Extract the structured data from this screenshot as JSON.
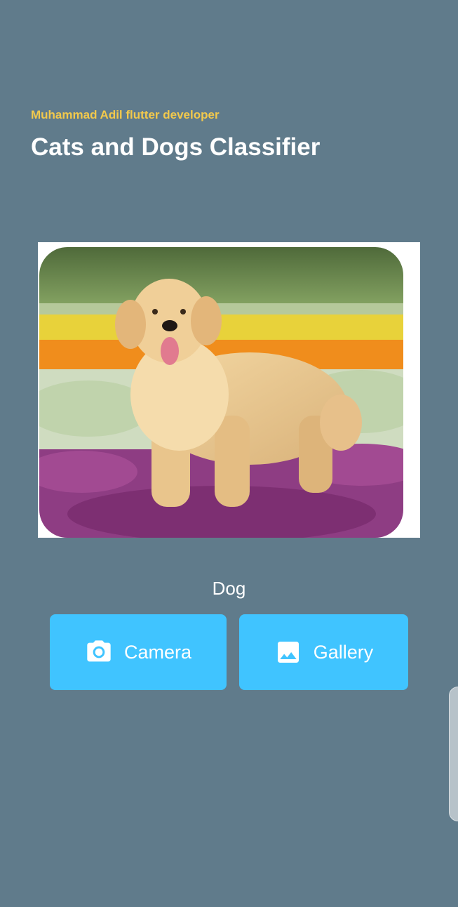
{
  "header": {
    "subtitle": "Muhammad Adil flutter developer",
    "title": "Cats and Dogs Classifier"
  },
  "image": {
    "subject": "dog",
    "content_icon": "golden-retriever-photo"
  },
  "result": {
    "label": "Dog"
  },
  "buttons": {
    "camera": {
      "label": "Camera",
      "icon": "camera-icon"
    },
    "gallery": {
      "label": "Gallery",
      "icon": "image-icon"
    }
  },
  "colors": {
    "background": "#607b8b",
    "subtitle": "#f2c94c",
    "button": "#40c4ff",
    "text": "#ffffff"
  }
}
